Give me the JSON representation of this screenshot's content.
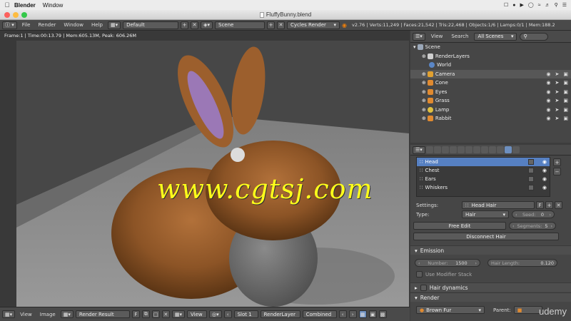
{
  "macbar": {
    "app": "Blender",
    "menus": [
      "Window"
    ]
  },
  "window": {
    "title": "FluffyBunny.blend"
  },
  "info_header": {
    "menus": [
      "File",
      "Render",
      "Window",
      "Help"
    ],
    "screen_layout": "Default",
    "scene": "Scene",
    "engine": "Cycles Render",
    "stats": "v2.76 | Verts:11,249 | Faces:21,542 | Tris:22,468 | Objects:1/6 | Lamps:0/1 | Mem:188.2"
  },
  "viewport": {
    "render_info": "Frame:1 | Time:00:13.79 | Mem:605.13M, Peak: 606.26M",
    "watermark": "www.cgtsj.com"
  },
  "image_header": {
    "menus": [
      "View",
      "Image"
    ],
    "image": "Render Result",
    "fake_user": "F",
    "view": "View",
    "slot": "Slot 1",
    "layer": "RenderLayer",
    "pass": "Combined"
  },
  "outliner": {
    "view": "View",
    "search": "Search",
    "filter": "All Scenes",
    "items": [
      {
        "label": "Scene",
        "icon": "scene-icon",
        "color": "#9aa7b8"
      },
      {
        "label": "RenderLayers",
        "icon": "renderlayers-icon",
        "color": "#cfcfcf"
      },
      {
        "label": "World",
        "icon": "world-icon",
        "color": "#5a86c6"
      },
      {
        "label": "Camera",
        "icon": "camera-icon",
        "color": "#e0a030"
      },
      {
        "label": "Cone",
        "icon": "mesh-icon",
        "color": "#e08a30"
      },
      {
        "label": "Eyes",
        "icon": "mesh-icon",
        "color": "#e08a30"
      },
      {
        "label": "Grass",
        "icon": "mesh-icon",
        "color": "#e08a30"
      },
      {
        "label": "Lamp",
        "icon": "lamp-icon",
        "color": "#e0c040"
      },
      {
        "label": "Rabbit",
        "icon": "mesh-icon",
        "color": "#e08a30"
      }
    ]
  },
  "properties": {
    "particle_systems": [
      "Head",
      "Chest",
      "Ears",
      "Whiskers"
    ],
    "settings_label": "Settings:",
    "settings_value": "Head Hair",
    "settings_fake": "F",
    "type_label": "Type:",
    "type_value": "Hair",
    "seed_label": "Seed:",
    "seed_value": "0",
    "free_edit": "Free Edit",
    "segments_label": "Segments:",
    "segments_value": "5",
    "disconnect_hair": "Disconnect Hair",
    "emission_label": "Emission",
    "number_label": "Number:",
    "number_value": "1500",
    "hair_length_label": "Hair Length:",
    "hair_length_value": "0.120",
    "use_modifier_stack": "Use Modifier Stack",
    "hair_dynamics": "Hair dynamics",
    "render_label": "Render",
    "material": "Brown Fur",
    "parent_label": "Parent:",
    "udemy": "udemy"
  }
}
